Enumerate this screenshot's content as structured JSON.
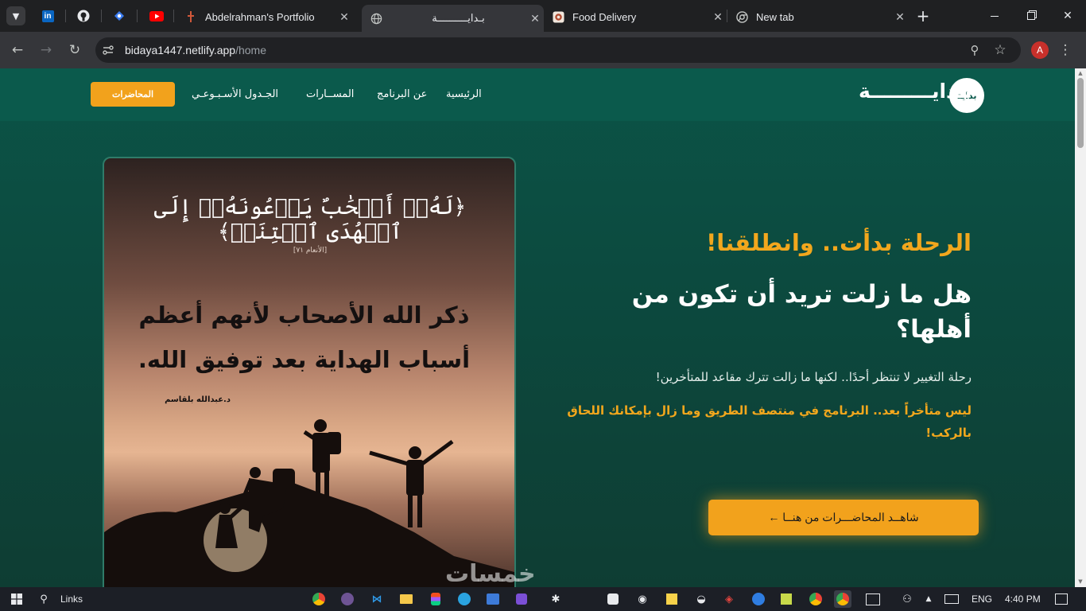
{
  "browser": {
    "pinned_tabs": [
      "linkedin-icon",
      "github-icon",
      "code-icon",
      "youtube-icon"
    ],
    "tabs": [
      {
        "title": "Abdelrahman's Portfolio",
        "icon": "portfolio-icon"
      },
      {
        "title": "بـدايــــــــــة",
        "icon": "globe-icon",
        "active": true
      },
      {
        "title": "Food Delivery",
        "icon": "food-icon"
      },
      {
        "title": "New tab",
        "icon": "chrome-icon"
      }
    ],
    "new_tab_symbol": "+",
    "close_symbol": "✕",
    "url_host": "bidaya1447.netlify.app",
    "url_path": "/home",
    "avatar_letter": "A"
  },
  "site": {
    "logo_text": "بـدايـــــــــة",
    "logo_badge": "بداية",
    "nav": [
      "الرئيسية",
      "عن البرنامج",
      "المســارات",
      "الجـدول الأسـبـوعـي"
    ],
    "nav_button": "المحاضرات",
    "colors": {
      "accent": "#f2a21c",
      "bg": "#0c4a3f"
    }
  },
  "hero": {
    "kicker": "الرحلة بدأت.. وانطلقنا!",
    "heading": "هل ما زلت تريد أن تكون من أهلها؟",
    "paragraph": "رحلة التغيير لا تنتظر أحدًا.. لكنها ما زالت تترك مقاعد للمتأخرين!",
    "highlight": "ليس متأخراً بعد.. البرنامج في منتصف الطريق وما زال بإمكانك اللحاق بالركب!",
    "cta": "شاهــد المحاضـــرات من هنــا ←"
  },
  "poster": {
    "verse": "﴿لَهُۥٓ أَصۡحَٰبٌ يَدۡعُونَهُۥٓ إِلَى ٱلۡهُدَى ٱئۡتِنَاۗ﴾",
    "reference": "[الأنعام ٧١]",
    "body": "ذكر الله الأصحاب لأنهم أعظم أسباب الهداية بعد توفيق الله.",
    "signature": "د.عبدالله بلقاسم"
  },
  "watermark": "خمسات",
  "taskbar": {
    "links_label": "Links",
    "language": "ENG",
    "time": "4:40 PM"
  }
}
